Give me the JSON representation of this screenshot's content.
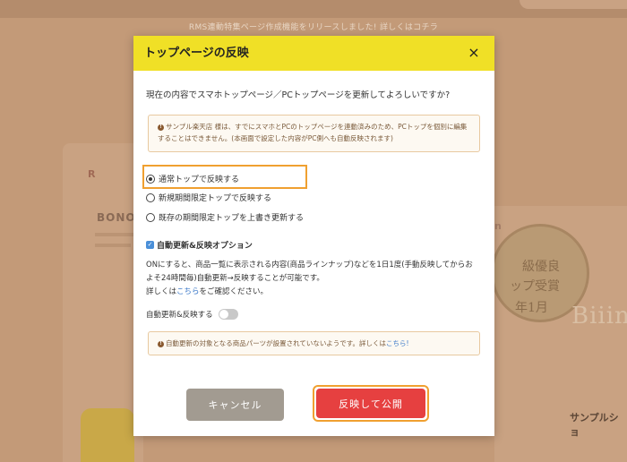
{
  "background": {
    "banner_text": "RMS連動特集ページ作成機能をリリースしました! 詳しくはコチラ",
    "left_card_r": "R",
    "left_card_brand": "BONO",
    "right_card_prefix": "n",
    "seal_line1": "級優良",
    "seal_line2": "ップ受賞",
    "seal_line3": "年1月",
    "brand_large": "Biiin",
    "shop_text": "サンプルショ"
  },
  "modal": {
    "title": "トップページの反映",
    "close_glyph": "×",
    "question": "現在の内容でスマホトップページ／PCトップページを更新してよろしいですか?",
    "warning_icon": "!",
    "warning_line1": "サンプル楽天店 様は、すでにスマホとPCのトップページを連動済みのため、PCトップを個別に編集",
    "warning_line2": "することはできません。(本画面で設定した内容がPC側へも自動反映されます)",
    "radio_options": [
      {
        "label": "通常トップで反映する",
        "checked": true
      },
      {
        "label": "新規期間限定トップで反映する",
        "checked": false
      },
      {
        "label": "既存の期間限定トップを上書き更新する",
        "checked": false
      }
    ],
    "option_heading": "自動更新&反映オプション",
    "desc_line1": "ONにすると、商品一覧に表示される内容(商品ラインナップ)などを1日1度(手動反映してからお",
    "desc_line2": "よそ24時間毎)自動更新→反映することが可能です。",
    "desc_line3_prefix": "詳しくは",
    "desc_link": "こちら",
    "desc_line3_suffix": "をご確認ください。",
    "toggle_label": "自動更新&反映する",
    "info_icon": "!",
    "info_text": "自動更新の対象となる商品パーツが設置されていないようです。詳しくは",
    "info_link": "こちら!",
    "cancel_label": "キャンセル",
    "publish_label": "反映して公開"
  },
  "colors": {
    "header_yellow": "#f0e026",
    "publish_red": "#e64040",
    "highlight_orange": "#f0a030",
    "cancel_gray": "#a29b91",
    "link_blue": "#3a78c8"
  }
}
